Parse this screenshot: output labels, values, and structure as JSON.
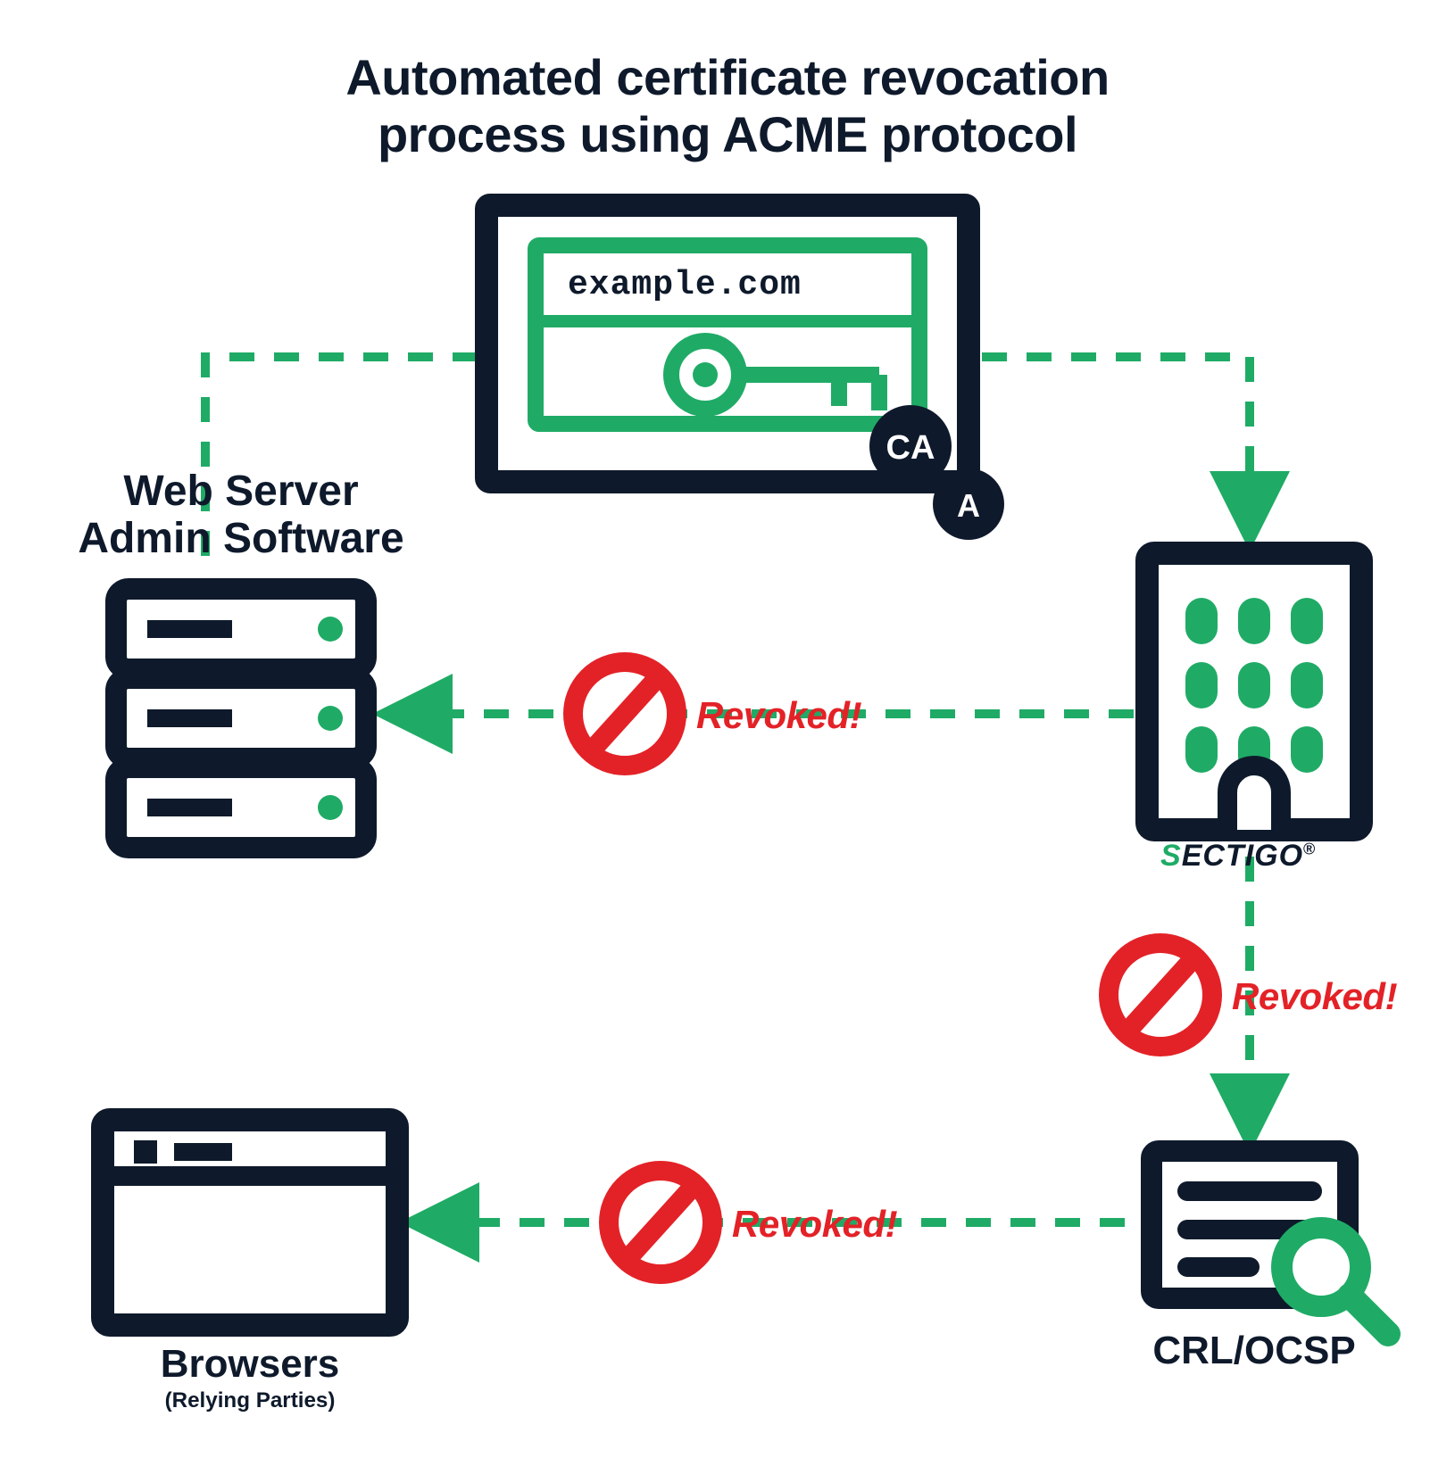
{
  "title_line1": "Automated certificate revocation",
  "title_line2": "process using ACME protocol",
  "nodes": {
    "certificate": {
      "domain": "example.com",
      "badge_ca": "CA",
      "badge_a": "A"
    },
    "webserver": {
      "label_line1": "Web Server",
      "label_line2": "Admin Software"
    },
    "ca_brand": "SECTIGO",
    "crl_ocsp": "CRL/OCSP",
    "browsers": {
      "label": "Browsers",
      "sub": "(Relying Parties)"
    }
  },
  "edge_label": "Revoked!",
  "colors": {
    "navy": "#0e1a2b",
    "green": "#1fab66",
    "red": "#e32227"
  }
}
